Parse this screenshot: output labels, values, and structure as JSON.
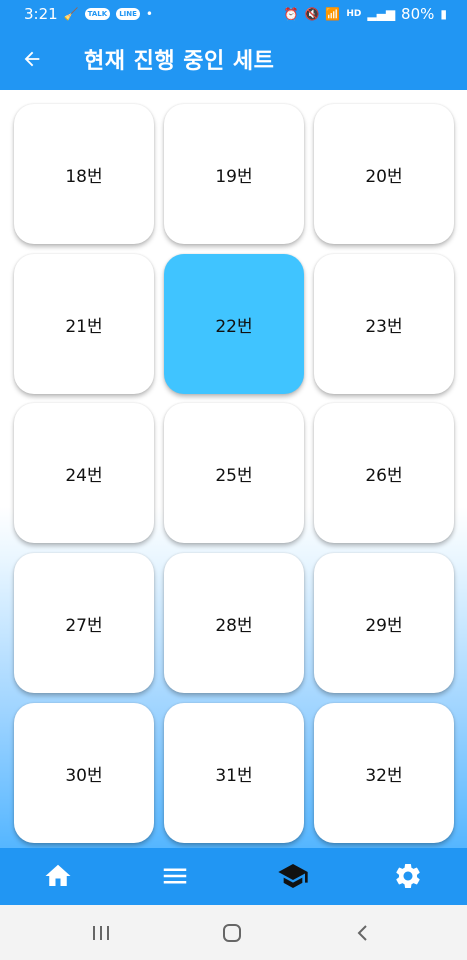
{
  "status_bar": {
    "time": "3:21",
    "badge_talk": "TALK",
    "badge_line": "LINE",
    "hd_label": "HD",
    "battery": "80%"
  },
  "app_bar": {
    "title": "현재 진행 중인 세트",
    "back_icon": "arrow-left-icon"
  },
  "sets": [
    {
      "label": "18번",
      "selected": false
    },
    {
      "label": "19번",
      "selected": false
    },
    {
      "label": "20번",
      "selected": false
    },
    {
      "label": "21번",
      "selected": false
    },
    {
      "label": "22번",
      "selected": true
    },
    {
      "label": "23번",
      "selected": false
    },
    {
      "label": "24번",
      "selected": false
    },
    {
      "label": "25번",
      "selected": false
    },
    {
      "label": "26번",
      "selected": false
    },
    {
      "label": "27번",
      "selected": false
    },
    {
      "label": "28번",
      "selected": false
    },
    {
      "label": "29번",
      "selected": false
    },
    {
      "label": "30번",
      "selected": false
    },
    {
      "label": "31번",
      "selected": false
    },
    {
      "label": "32번",
      "selected": false
    }
  ],
  "bottom_nav": [
    {
      "icon": "home-icon",
      "active": false
    },
    {
      "icon": "menu-icon",
      "active": false
    },
    {
      "icon": "graduation-cap-icon",
      "active": true
    },
    {
      "icon": "settings-gear-icon",
      "active": false
    }
  ],
  "colors": {
    "primary": "#2196f3",
    "selected_tile": "#40c4ff",
    "active_nav_icon": "#111111",
    "nav_icon": "#ffffff"
  }
}
